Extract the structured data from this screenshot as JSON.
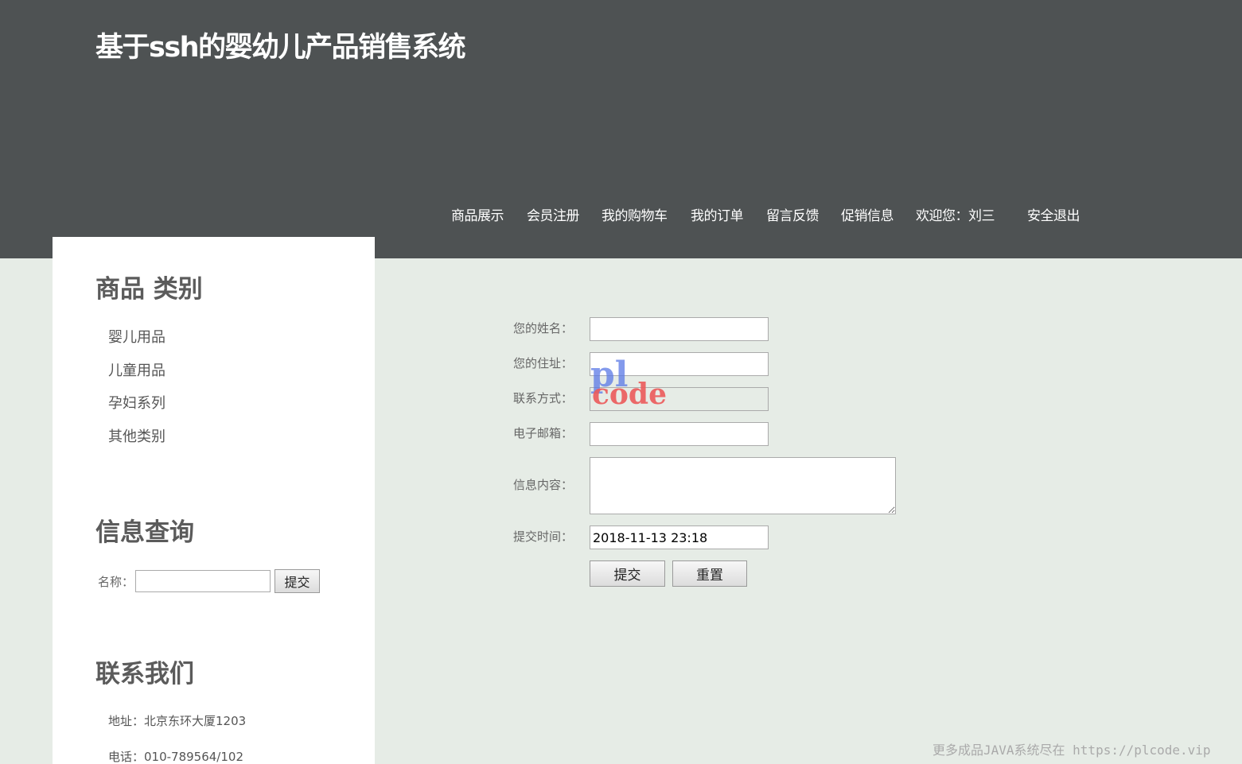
{
  "header": {
    "site_title": "基于ssh的婴幼儿产品销售系统",
    "nav": [
      {
        "label": "商品展示"
      },
      {
        "label": "会员注册"
      },
      {
        "label": "我的购物车"
      },
      {
        "label": "我的订单"
      },
      {
        "label": "留言反馈"
      },
      {
        "label": "促销信息"
      },
      {
        "label": "欢迎您：刘三"
      },
      {
        "label": "安全退出"
      }
    ]
  },
  "sidebar": {
    "category_heading": "商品 类别",
    "categories": [
      {
        "label": "婴儿用品"
      },
      {
        "label": "儿童用品"
      },
      {
        "label": "孕妇系列"
      },
      {
        "label": "其他类别"
      }
    ],
    "search_heading": "信息查询",
    "search_label": "名称：",
    "search_value": "",
    "search_button": "提交",
    "contact_heading": "联系我们",
    "contact_address": "地址：北京东环大厦1203",
    "contact_phone": "电话：010-789564/102"
  },
  "form": {
    "name_label": "您的姓名：",
    "name_value": "",
    "address_label": "您的住址：",
    "address_value": "",
    "contact_label": "联系方式：",
    "contact_value": "",
    "email_label": "电子邮箱：",
    "email_value": "",
    "message_label": "信息内容：",
    "message_value": "",
    "time_label": "提交时间：",
    "time_value": "2018-11-13 23:18",
    "submit_label": "提交",
    "reset_label": "重置"
  },
  "watermark": {
    "logo_top": "pl",
    "logo_bottom": "code",
    "footer_text": "更多成品JAVA系统尽在 https://plcode.vip"
  },
  "colors": {
    "header_bg": "#4e5253",
    "page_bg": "#e6ece6",
    "sidebar_bg": "#ffffff"
  }
}
